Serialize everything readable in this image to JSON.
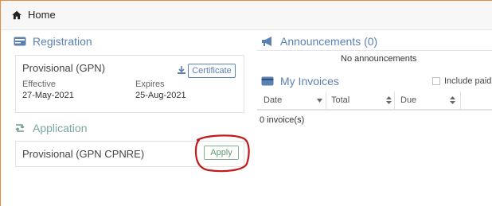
{
  "breadcrumb": {
    "home_label": "Home"
  },
  "registration": {
    "title": "Registration",
    "name": "Provisional (GPN)",
    "certificate_label": "Certificate",
    "effective_label": "Effective",
    "effective_value": "27-May-2021",
    "expires_label": "Expires",
    "expires_value": "25-Aug-2021"
  },
  "application": {
    "title": "Application",
    "name": "Provisional (GPN CPNRE)",
    "apply_label": "Apply"
  },
  "announcements": {
    "title": "Announcements (0)",
    "empty_text": "No announcements"
  },
  "invoices": {
    "title": "My Invoices",
    "include_paid_label": "Include paid",
    "columns": [
      "Date",
      "Total",
      "Due"
    ],
    "count_text": "0 invoice(s)"
  },
  "colors": {
    "accent_blue": "#5b80b2",
    "accent_green": "#7aa7a0",
    "apply_green": "#5a9b6b",
    "frame_orange": "#f08a3a",
    "annotation_red": "#c21a1a"
  },
  "icons": {
    "home": "home-icon",
    "registration": "id-card-icon",
    "download": "download-icon",
    "application": "retweet-icon",
    "announcements": "megaphone-icon",
    "invoices": "credit-card-icon",
    "checkbox": "checkbox-icon",
    "sort": "sort-icon"
  }
}
